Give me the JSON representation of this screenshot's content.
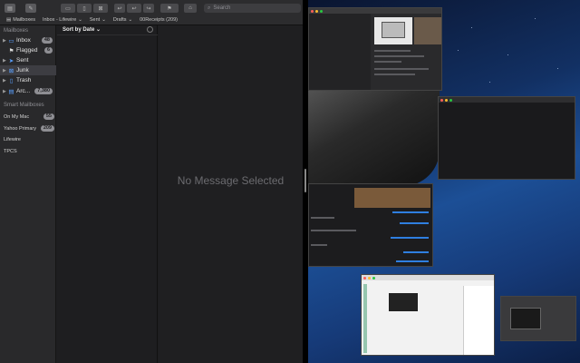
{
  "toolbar": {
    "search_placeholder": "Search",
    "favorites": [
      "Mailboxes",
      "Inbox - Lifewire",
      "Sent",
      "Drafts",
      "00Receipts (209)"
    ]
  },
  "sidebar": {
    "mailboxes_header": "Mailboxes",
    "items": [
      {
        "label": "Inbox",
        "icon": "inbox-icon",
        "badge": "48"
      },
      {
        "label": "Flagged",
        "icon": "flag-icon",
        "badge": "6"
      },
      {
        "label": "Sent",
        "icon": "paperplane-icon",
        "badge": ""
      },
      {
        "label": "Junk",
        "icon": "junk-icon",
        "badge": ""
      },
      {
        "label": "Trash",
        "icon": "trash-icon",
        "badge": ""
      },
      {
        "label": "Arc...",
        "icon": "archive-icon",
        "badge": "7,380"
      }
    ],
    "smart_header": "Smart Mailboxes",
    "accounts": [
      {
        "label": "On My Mac",
        "badge": "55"
      },
      {
        "label": "Yahoo Primary",
        "badge": "209"
      },
      {
        "label": "Lifewire",
        "badge": ""
      },
      {
        "label": "TPCS",
        "badge": ""
      }
    ]
  },
  "message_list": {
    "sort_label": "Sort by Date"
  },
  "preview": {
    "empty_text": "No Message Selected"
  },
  "colors": {
    "accent": "#2f7fe0",
    "sidebar_bg": "#29292b",
    "window_bg": "#1e1e20"
  }
}
